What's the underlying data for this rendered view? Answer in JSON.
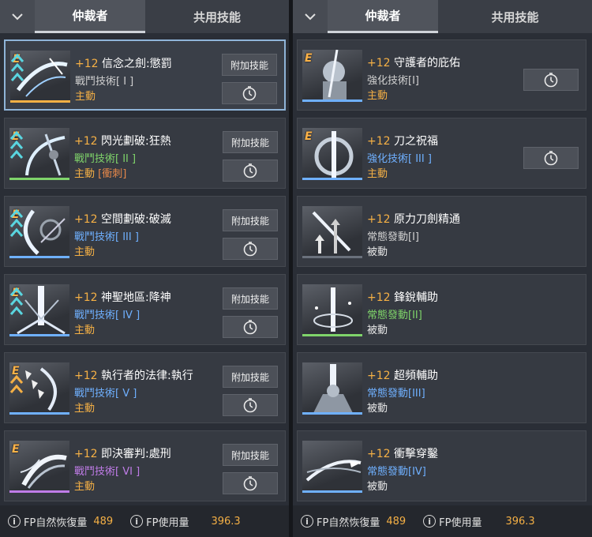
{
  "colors": {
    "accent_gold": "#f5b045",
    "battle_green": "#7fd46a",
    "battle_blue": "#6fb0ff",
    "battle_purple": "#c07ce8",
    "selected_border": "#8fb4d8"
  },
  "left": {
    "tabs": {
      "active": "仲裁者",
      "inactive": "共用技能"
    },
    "skills": [
      {
        "level": "+12",
        "name": "信念之劍:懲罰",
        "category": "戰鬥技術[ I ]",
        "type": "主動",
        "tag": "",
        "add_label": "附加技能",
        "icon": "sword-slash-icon"
      },
      {
        "level": "+12",
        "name": "閃光劃破:狂熱",
        "category": "戰鬥技術[ II ]",
        "type": "主動",
        "tag": "[衝刺]",
        "add_label": "附加技能",
        "icon": "flash-cut-icon"
      },
      {
        "level": "+12",
        "name": "空間劃破:破滅",
        "category": "戰鬥技術[ III ]",
        "type": "主動",
        "tag": "",
        "add_label": "附加技能",
        "icon": "space-cut-icon"
      },
      {
        "level": "+12",
        "name": "神聖地區:降神",
        "category": "戰鬥技術[ IV ]",
        "type": "主動",
        "tag": "",
        "add_label": "附加技能",
        "icon": "holy-zone-icon"
      },
      {
        "level": "+12",
        "name": "執行者的法律:執行",
        "category": "戰鬥技術[ V ]",
        "type": "主動",
        "tag": "",
        "add_label": "附加技能",
        "icon": "executor-law-icon"
      },
      {
        "level": "+12",
        "name": "即決審判:處刑",
        "category": "戰鬥技術[ VI ]",
        "type": "主動",
        "tag": "",
        "add_label": "附加技能",
        "icon": "judgment-icon"
      }
    ],
    "footer": {
      "fp_recover_label": "FP自然恢復量",
      "fp_recover_value": "489",
      "fp_use_label": "FP使用量",
      "fp_use_value": "396.3"
    }
  },
  "right": {
    "tabs": {
      "active": "仲裁者",
      "inactive": "共用技能"
    },
    "skills": [
      {
        "level": "+12",
        "name": "守護者的庇佑",
        "category": "強化技術[I]",
        "type": "主動",
        "icon": "guardian-blessing-icon"
      },
      {
        "level": "+12",
        "name": "刀之祝福",
        "category": "強化技術[ III ]",
        "type": "主動",
        "icon": "blade-blessing-icon"
      },
      {
        "level": "+12",
        "name": "原力刀劍精通",
        "category": "常態發動[I]",
        "type": "被動",
        "icon": "force-sword-mastery-icon"
      },
      {
        "level": "+12",
        "name": "鋒銳輔助",
        "category": "常態發動[II]",
        "type": "被動",
        "icon": "sharp-assist-icon"
      },
      {
        "level": "+12",
        "name": "超頻輔助",
        "category": "常態發動[III]",
        "type": "被動",
        "icon": "overclock-assist-icon"
      },
      {
        "level": "+12",
        "name": "衝擊穿鑿",
        "category": "常態發動[IV]",
        "type": "被動",
        "icon": "impact-pierce-icon"
      }
    ],
    "footer": {
      "fp_recover_label": "FP自然恢復量",
      "fp_recover_value": "489",
      "fp_use_label": "FP使用量",
      "fp_use_value": "396.3"
    }
  }
}
